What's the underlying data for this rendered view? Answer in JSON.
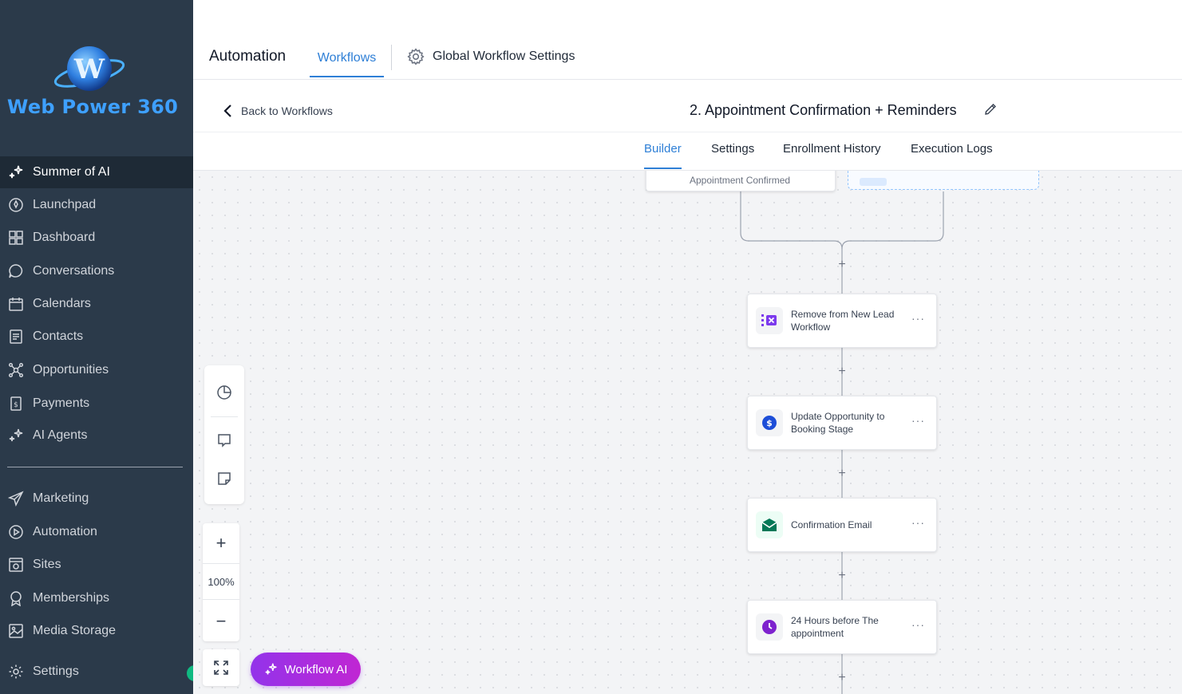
{
  "brand": {
    "name": "Web Power 360"
  },
  "sidebar": {
    "items": [
      {
        "label": "Summer of AI",
        "icon": "sparkle-icon"
      },
      {
        "label": "Launchpad",
        "icon": "rocket-icon"
      },
      {
        "label": "Dashboard",
        "icon": "dashboard-icon"
      },
      {
        "label": "Conversations",
        "icon": "chat-icon"
      },
      {
        "label": "Calendars",
        "icon": "calendar-icon"
      },
      {
        "label": "Contacts",
        "icon": "contacts-icon"
      },
      {
        "label": "Opportunities",
        "icon": "opportunities-icon"
      },
      {
        "label": "Payments",
        "icon": "payments-icon"
      },
      {
        "label": "AI Agents",
        "icon": "sparkle-icon"
      },
      {
        "label": "Marketing",
        "icon": "send-icon"
      },
      {
        "label": "Automation",
        "icon": "automation-icon"
      },
      {
        "label": "Sites",
        "icon": "sites-icon"
      },
      {
        "label": "Memberships",
        "icon": "badge-icon"
      },
      {
        "label": "Media Storage",
        "icon": "image-icon"
      },
      {
        "label": "Settings",
        "icon": "gear-icon"
      }
    ]
  },
  "header": {
    "title": "Automation",
    "tab": "Workflows",
    "global_settings": "Global Workflow Settings"
  },
  "workflow": {
    "back_label": "Back to Workflows",
    "title": "2. Appointment Confirmation + Reminders",
    "tabs": [
      "Builder",
      "Settings",
      "Enrollment History",
      "Execution Logs"
    ],
    "active_tab": "Builder"
  },
  "canvas": {
    "trigger_partial": "Appointment Confirmed",
    "nodes": [
      {
        "label": "Remove from New Lead Workflow",
        "icon": "remove-workflow-icon",
        "color": "#7c3aed"
      },
      {
        "label": "Update Opportunity to Booking Stage",
        "icon": "dollar-icon",
        "color": "#1d4ed8"
      },
      {
        "label": "Confirmation Email",
        "icon": "email-icon",
        "color": "#047857"
      },
      {
        "label": "24 Hours before The appointment",
        "icon": "clock-icon",
        "color": "#7e22ce"
      }
    ],
    "more_label": "···",
    "zoom": "100%",
    "ai_button": "Workflow AI"
  }
}
